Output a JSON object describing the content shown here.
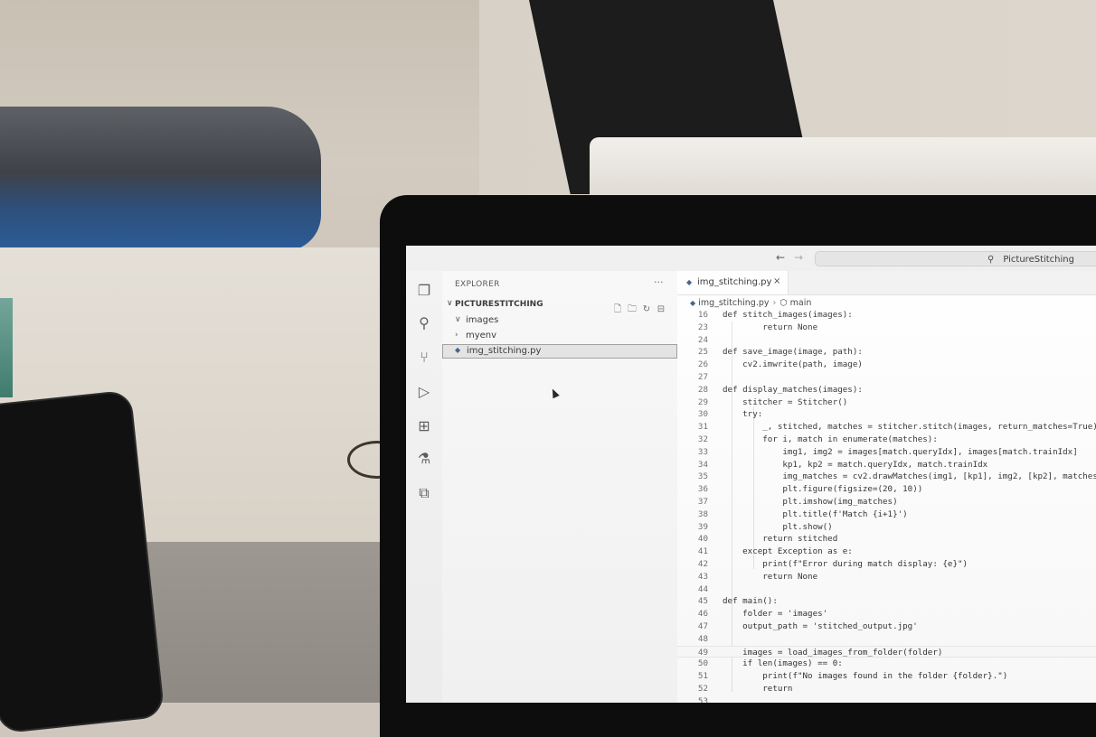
{
  "titlebar": {
    "back_arrow": "←",
    "forward_arrow": "→",
    "search_text": "PictureStitching"
  },
  "activity_bar": {
    "icons": [
      "files-icon",
      "search-icon",
      "source-control-icon",
      "run-debug-icon",
      "extensions-icon",
      "testing-icon",
      "remote-explorer-icon"
    ]
  },
  "sidebar": {
    "title": "EXPLORER",
    "more": "···",
    "folder": "PICTURESTITCHING",
    "items": [
      {
        "label": "images",
        "chevron": "∨"
      },
      {
        "label": "myenv",
        "chevron": "›"
      },
      {
        "label": "img_stitching.py",
        "selected": true
      }
    ]
  },
  "editor": {
    "tab_label": "img_stitching.py",
    "tab_close": "×",
    "breadcrumb_file": "img_stitching.py",
    "breadcrumb_symbol": "main",
    "lines": [
      {
        "n": "16",
        "code": "def stitch_images(images):"
      },
      {
        "n": "23",
        "code": "        return None"
      },
      {
        "n": "24",
        "code": ""
      },
      {
        "n": "25",
        "code": "def save_image(image, path):"
      },
      {
        "n": "26",
        "code": "    cv2.imwrite(path, image)"
      },
      {
        "n": "27",
        "code": ""
      },
      {
        "n": "28",
        "code": "def display_matches(images):"
      },
      {
        "n": "29",
        "code": "    stitcher = Stitcher()"
      },
      {
        "n": "30",
        "code": "    try:"
      },
      {
        "n": "31",
        "code": "        _, stitched, matches = stitcher.stitch(images, return_matches=True)"
      },
      {
        "n": "32",
        "code": "        for i, match in enumerate(matches):"
      },
      {
        "n": "33",
        "code": "            img1, img2 = images[match.queryIdx], images[match.trainIdx]"
      },
      {
        "n": "34",
        "code": "            kp1, kp2 = match.queryIdx, match.trainIdx"
      },
      {
        "n": "35",
        "code": "            img_matches = cv2.drawMatches(img1, [kp1], img2, [kp2], matches"
      },
      {
        "n": "36",
        "code": "            plt.figure(figsize=(20, 10))"
      },
      {
        "n": "37",
        "code": "            plt.imshow(img_matches)"
      },
      {
        "n": "38",
        "code": "            plt.title(f'Match {i+1}')"
      },
      {
        "n": "39",
        "code": "            plt.show()"
      },
      {
        "n": "40",
        "code": "        return stitched"
      },
      {
        "n": "41",
        "code": "    except Exception as e:"
      },
      {
        "n": "42",
        "code": "        print(f\"Error during match display: {e}\")"
      },
      {
        "n": "43",
        "code": "        return None"
      },
      {
        "n": "44",
        "code": ""
      },
      {
        "n": "45",
        "code": "def main():"
      },
      {
        "n": "46",
        "code": "    folder = 'images'"
      },
      {
        "n": "47",
        "code": "    output_path = 'stitched_output.jpg'"
      },
      {
        "n": "48",
        "code": ""
      },
      {
        "n": "49",
        "code": "    images = load_images_from_folder(folder)"
      },
      {
        "n": "50",
        "code": "    if len(images) == 0:"
      },
      {
        "n": "51",
        "code": "        print(f\"No images found in the folder {folder}.\")"
      },
      {
        "n": "52",
        "code": "        return"
      },
      {
        "n": "53",
        "code": ""
      }
    ]
  }
}
